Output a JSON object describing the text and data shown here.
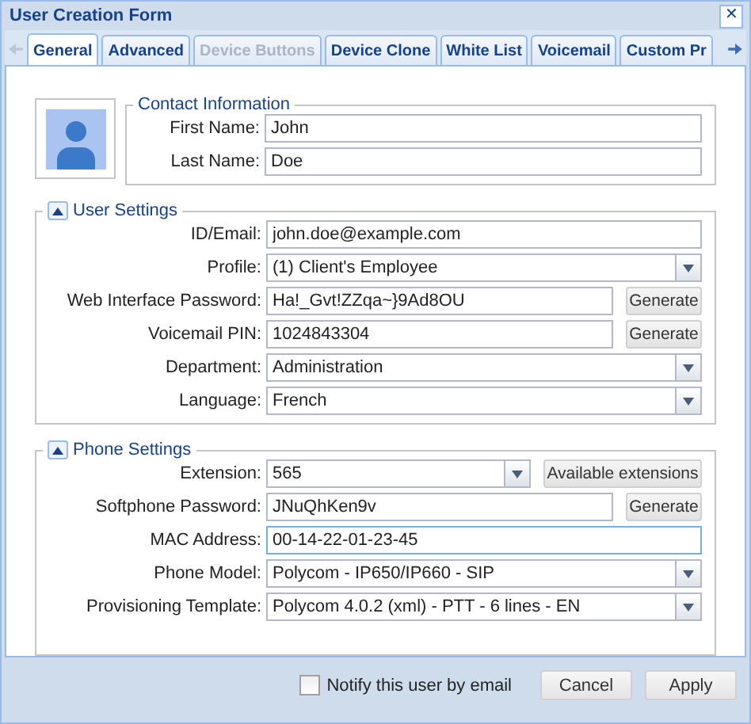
{
  "window": {
    "title": "User Creation Form",
    "close": "✕"
  },
  "tabs": [
    {
      "label": "General",
      "selected": true,
      "disabled": false
    },
    {
      "label": "Advanced",
      "selected": false,
      "disabled": false
    },
    {
      "label": "Device Buttons",
      "selected": false,
      "disabled": true
    },
    {
      "label": "Device Clone",
      "selected": false,
      "disabled": false
    },
    {
      "label": "White List",
      "selected": false,
      "disabled": false
    },
    {
      "label": "Voicemail",
      "selected": false,
      "disabled": false
    },
    {
      "label": "Custom Pr",
      "selected": false,
      "disabled": false
    }
  ],
  "contact": {
    "legend": "Contact Information",
    "fields": [
      {
        "kind": "text",
        "label": "First Name:",
        "value": "John"
      },
      {
        "kind": "text",
        "label": "Last Name:",
        "value": "Doe"
      }
    ]
  },
  "sections": [
    {
      "legend": "User Settings",
      "expanded": true,
      "fields": [
        {
          "kind": "text",
          "label": "ID/Email:",
          "value": "john.doe@example.com"
        },
        {
          "kind": "select",
          "label": "Profile:",
          "value": "(1) Client's Employee"
        },
        {
          "kind": "text",
          "label": "Web Interface Password:",
          "value": "Ha!_Gvt!ZZqa~}9Ad8OU",
          "button": "Generate"
        },
        {
          "kind": "text",
          "label": "Voicemail PIN:",
          "value": "1024843304",
          "button": "Generate"
        },
        {
          "kind": "select",
          "label": "Department:",
          "value": "Administration"
        },
        {
          "kind": "select",
          "label": "Language:",
          "value": "French"
        }
      ]
    },
    {
      "legend": "Phone Settings",
      "expanded": true,
      "fields": [
        {
          "kind": "select",
          "label": "Extension:",
          "value": "565",
          "button": "Available extensions"
        },
        {
          "kind": "text",
          "label": "Softphone Password:",
          "value": "JNuQhKen9v",
          "button": "Generate"
        },
        {
          "kind": "text",
          "label": "MAC Address:",
          "value": "00-14-22-01-23-45",
          "focused": true
        },
        {
          "kind": "select",
          "label": "Phone Model:",
          "value": "Polycom - IP650/IP660 - SIP"
        },
        {
          "kind": "select",
          "label": "Provisioning Template:",
          "value": "Polycom 4.0.2 (xml) - PTT - 6 lines - EN"
        }
      ]
    }
  ],
  "footer": {
    "notify": {
      "label": "Notify this user by email",
      "checked": false
    },
    "buttons": [
      "Cancel",
      "Apply"
    ]
  }
}
